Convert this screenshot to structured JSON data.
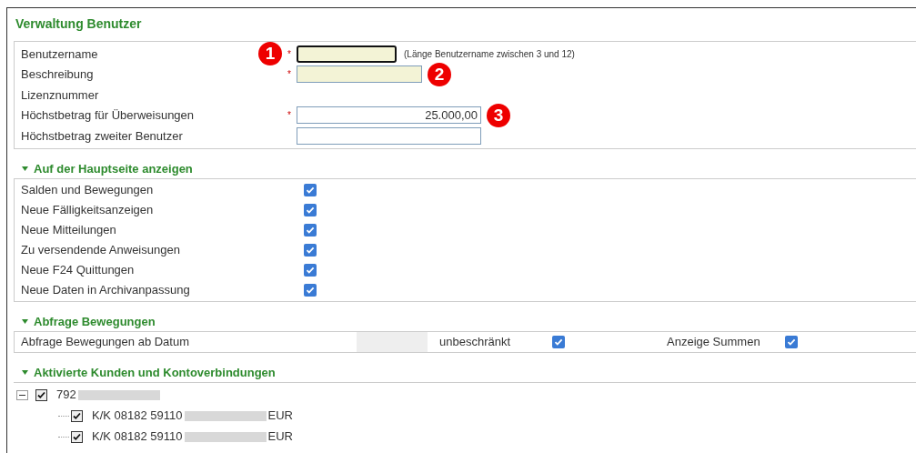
{
  "title": "Verwaltung Benutzer",
  "fields": [
    {
      "label": "Benutzername",
      "kind": "input",
      "required_mark": "*",
      "highlighted": true,
      "focused": true,
      "hint": "(Länge Benutzername zwischen 3 und 12)",
      "marker": "1"
    },
    {
      "label": "Beschreibung",
      "kind": "input",
      "required_mark": "*",
      "highlighted": true,
      "focused": false,
      "marker": "2"
    },
    {
      "label": "Lizenznummer",
      "kind": "text"
    },
    {
      "label": "Höchstbetrag für Überweisungen",
      "kind": "input",
      "required_mark": "*",
      "highlighted": false,
      "focused": false,
      "value": "25.000,00",
      "marker": "3"
    },
    {
      "label": "Höchstbetrag zweiter Benutzer",
      "kind": "input",
      "highlighted": false,
      "focused": false
    }
  ],
  "home_section": {
    "title": "Auf der Hauptseite anzeigen",
    "expanded": true,
    "items": [
      {
        "label": "Salden und Bewegungen",
        "checked": true
      },
      {
        "label": "Neue Fälligkeitsanzeigen",
        "checked": true
      },
      {
        "label": "Neue Mitteilungen",
        "checked": true
      },
      {
        "label": "Zu versendende Anweisungen",
        "checked": true
      },
      {
        "label": "Neue F24 Quittungen",
        "checked": true
      },
      {
        "label": "Neue Daten in Archivanpassung",
        "checked": true
      }
    ]
  },
  "movements_section": {
    "title": "Abfrage Bewegungen",
    "expanded": true,
    "label": "Abfrage Bewegungen ab Datum",
    "date_disabled": true,
    "unlimited_label": "unbeschränkt",
    "unlimited_checked": true,
    "sums_label": "Anzeige Summen",
    "sums_checked": true
  },
  "accounts_section": {
    "title": "Aktivierte Kunden und Kontoverbindungen",
    "expanded": true,
    "tree": [
      {
        "prefix": "792",
        "redacted": true,
        "checked": true,
        "expanded": true,
        "children": [
          {
            "prefix": "K/K 08182 59110",
            "redacted": true,
            "suffix": "EUR",
            "checked": true
          },
          {
            "prefix": "K/K 08182 59110",
            "redacted": true,
            "suffix": "EUR",
            "checked": true
          }
        ]
      }
    ]
  }
}
